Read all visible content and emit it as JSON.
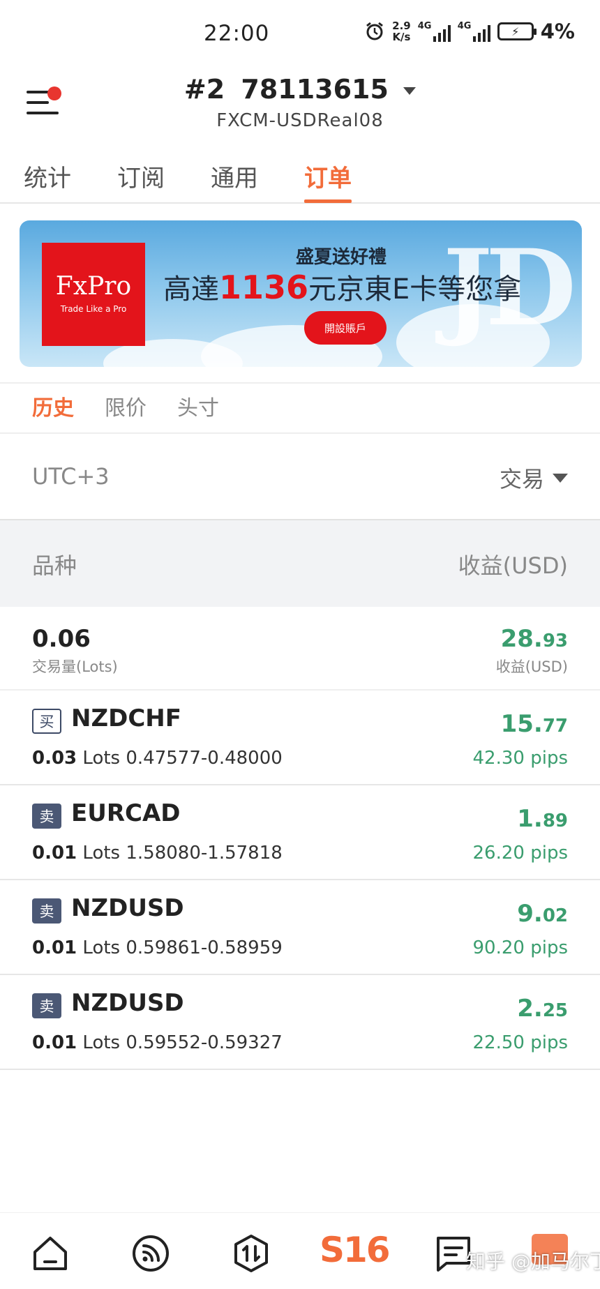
{
  "status_bar": {
    "time": "22:00",
    "net_speed_value": "2.9",
    "net_speed_unit": "K/s",
    "signal_tag": "4G",
    "battery": "4%"
  },
  "header": {
    "account_prefix": "#2",
    "account_number": "78113615",
    "server": "FXCM-USDReal08"
  },
  "tabs": [
    {
      "label": "统计",
      "active": false
    },
    {
      "label": "订阅",
      "active": false
    },
    {
      "label": "通用",
      "active": false
    },
    {
      "label": "订单",
      "active": true
    }
  ],
  "banner": {
    "logo": "FxPro",
    "logo_tagline": "Trade Like a Pro",
    "headline": "盛夏送好禮",
    "offer_prefix": "高達",
    "offer_amount": "1136",
    "offer_suffix": "元京東E卡等您拿",
    "button": "開設賬戶",
    "mark": "JD"
  },
  "subtabs": [
    {
      "label": "历史",
      "active": true
    },
    {
      "label": "限价",
      "active": false
    },
    {
      "label": "头寸",
      "active": false
    }
  ],
  "filter": {
    "timezone": "UTC+3",
    "type": "交易"
  },
  "table_header": {
    "symbol": "品种",
    "profit": "收益(USD)"
  },
  "summary": {
    "lots": "0.06",
    "lots_label": "交易量(Lots)",
    "profit_int": "28.",
    "profit_dec": "93",
    "profit_label": "收益(USD)"
  },
  "orders": [
    {
      "side": "买",
      "side_type": "buy",
      "symbol": "NZDCHF",
      "lots": "0.03",
      "lots_unit": "Lots",
      "prices": "0.47577-0.48000",
      "profit_int": "15.",
      "profit_dec": "77",
      "pips": "42.30 pips"
    },
    {
      "side": "卖",
      "side_type": "sell",
      "symbol": "EURCAD",
      "lots": "0.01",
      "lots_unit": "Lots",
      "prices": "1.58080-1.57818",
      "profit_int": "1.",
      "profit_dec": "89",
      "pips": "26.20 pips"
    },
    {
      "side": "卖",
      "side_type": "sell",
      "symbol": "NZDUSD",
      "lots": "0.01",
      "lots_unit": "Lots",
      "prices": "0.59861-0.58959",
      "profit_int": "9.",
      "profit_dec": "02",
      "pips": "90.20 pips"
    },
    {
      "side": "卖",
      "side_type": "sell",
      "symbol": "NZDUSD",
      "lots": "0.01",
      "lots_unit": "Lots",
      "prices": "0.59552-0.59327",
      "profit_int": "2.",
      "profit_dec": "25",
      "pips": "22.50 pips"
    }
  ],
  "bottom_nav": {
    "brand": "S16",
    "watermark": "知乎 @加马尔丁"
  },
  "colors": {
    "accent": "#f26c3a",
    "profit_green": "#3a9d6e",
    "brand_red": "#e3141b",
    "badge_blue": "#4b5875"
  }
}
